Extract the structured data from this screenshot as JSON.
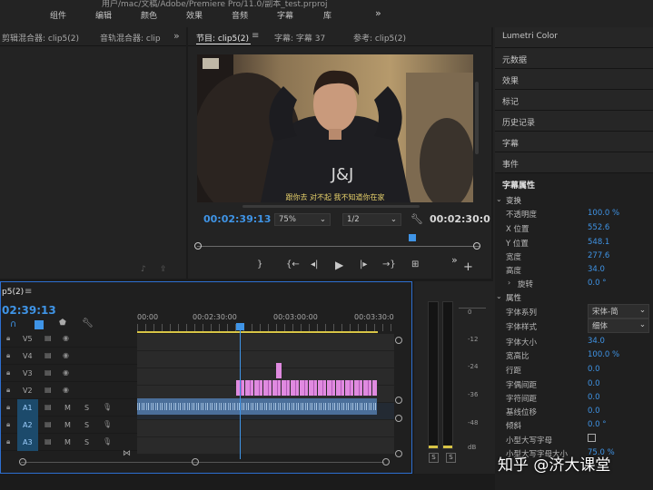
{
  "title_path": "用户/mac/文稿/Adobe/Premiere Pro/11.0/副本_test.prproj",
  "menu": [
    "组件",
    "编辑",
    "颜色",
    "效果",
    "音频",
    "字幕",
    "库"
  ],
  "menu_more": "»",
  "source_panel": {
    "tabs": [
      "剪辑混合器: clip5(2)",
      "音轨混合器: clip"
    ],
    "more": "»"
  },
  "program_panel": {
    "tabs": [
      "节目: clip5(2)",
      "字幕: 字幕 37",
      "参考: clip5(2)"
    ],
    "menu_icon": "≡",
    "subtitle": "跟你去  对不起  我不知道你在家",
    "timecode_left": "00:02:39:13",
    "zoom": "75%",
    "resolution": "1/2",
    "timecode_right": "00:02:30:0",
    "playhead_fraction": 0.76
  },
  "right_panel": {
    "tabs": [
      "Lumetri Color",
      "元数据",
      "效果",
      "标记",
      "历史记录",
      "字幕",
      "事件"
    ],
    "properties_title": "字幕属性",
    "transform_header": "变换",
    "transform": [
      {
        "label": "不透明度",
        "value": "100.0 %"
      },
      {
        "label": "X 位置",
        "value": "552.6"
      },
      {
        "label": "Y 位置",
        "value": "548.1"
      },
      {
        "label": "宽度",
        "value": "277.6"
      },
      {
        "label": "高度",
        "value": "34.0"
      },
      {
        "label": "旋转",
        "value": "0.0 °"
      }
    ],
    "attr_header": "属性",
    "font_family_label": "字体系列",
    "font_family": "宋体-简",
    "font_style_label": "字体样式",
    "font_style": "细体",
    "attributes": [
      {
        "label": "字体大小",
        "value": "34.0"
      },
      {
        "label": "宽高比",
        "value": "100.0 %"
      },
      {
        "label": "行距",
        "value": "0.0"
      },
      {
        "label": "字偶间距",
        "value": "0.0"
      },
      {
        "label": "字符间距",
        "value": "0.0"
      },
      {
        "label": "基线位移",
        "value": "0.0"
      },
      {
        "label": "倾斜",
        "value": "0.0 °"
      }
    ],
    "smallcaps_label": "小型大写字母",
    "smallcaps_size_label": "小型大写字母大小",
    "smallcaps_size_value": "75.0 %"
  },
  "timeline": {
    "tab": "p5(2)",
    "menu_icon": "≡",
    "timecode": "02:39:13",
    "ruler": [
      "00:00",
      "00:02:30:00",
      "00:03:00:00",
      "00:03:30:0"
    ],
    "video_tracks": [
      "V5",
      "V4",
      "V3",
      "V2"
    ],
    "audio_tracks": [
      "A1",
      "A2",
      "A3"
    ],
    "m_label": "M",
    "s_label": "S"
  },
  "audio_meter": {
    "ticks": [
      "0",
      "-12",
      "-24",
      "-36",
      "-48",
      "dB"
    ],
    "solo": [
      "S",
      "S"
    ]
  },
  "watermark": "知乎 @济大课堂",
  "colors": {
    "accent": "#3f94e6",
    "subtitle_clip": "#e08ae0",
    "audio_clip": "#4b6f9a",
    "panel_border": "#2d6fd1"
  }
}
